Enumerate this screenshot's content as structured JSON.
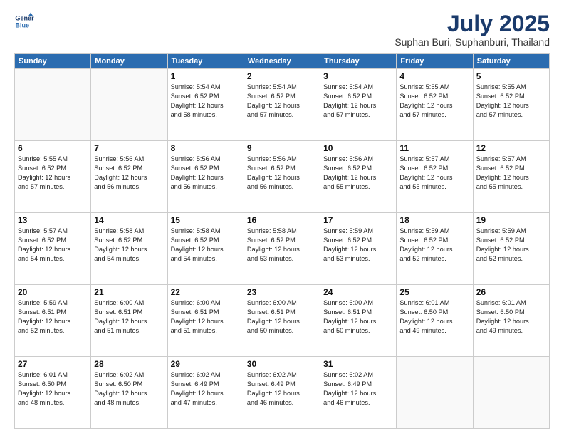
{
  "header": {
    "logo_line1": "General",
    "logo_line2": "Blue",
    "title": "July 2025",
    "subtitle": "Suphan Buri, Suphanburi, Thailand"
  },
  "calendar": {
    "days_of_week": [
      "Sunday",
      "Monday",
      "Tuesday",
      "Wednesday",
      "Thursday",
      "Friday",
      "Saturday"
    ],
    "weeks": [
      [
        {
          "day": "",
          "info": ""
        },
        {
          "day": "",
          "info": ""
        },
        {
          "day": "1",
          "info": "Sunrise: 5:54 AM\nSunset: 6:52 PM\nDaylight: 12 hours\nand 58 minutes."
        },
        {
          "day": "2",
          "info": "Sunrise: 5:54 AM\nSunset: 6:52 PM\nDaylight: 12 hours\nand 57 minutes."
        },
        {
          "day": "3",
          "info": "Sunrise: 5:54 AM\nSunset: 6:52 PM\nDaylight: 12 hours\nand 57 minutes."
        },
        {
          "day": "4",
          "info": "Sunrise: 5:55 AM\nSunset: 6:52 PM\nDaylight: 12 hours\nand 57 minutes."
        },
        {
          "day": "5",
          "info": "Sunrise: 5:55 AM\nSunset: 6:52 PM\nDaylight: 12 hours\nand 57 minutes."
        }
      ],
      [
        {
          "day": "6",
          "info": "Sunrise: 5:55 AM\nSunset: 6:52 PM\nDaylight: 12 hours\nand 57 minutes."
        },
        {
          "day": "7",
          "info": "Sunrise: 5:56 AM\nSunset: 6:52 PM\nDaylight: 12 hours\nand 56 minutes."
        },
        {
          "day": "8",
          "info": "Sunrise: 5:56 AM\nSunset: 6:52 PM\nDaylight: 12 hours\nand 56 minutes."
        },
        {
          "day": "9",
          "info": "Sunrise: 5:56 AM\nSunset: 6:52 PM\nDaylight: 12 hours\nand 56 minutes."
        },
        {
          "day": "10",
          "info": "Sunrise: 5:56 AM\nSunset: 6:52 PM\nDaylight: 12 hours\nand 55 minutes."
        },
        {
          "day": "11",
          "info": "Sunrise: 5:57 AM\nSunset: 6:52 PM\nDaylight: 12 hours\nand 55 minutes."
        },
        {
          "day": "12",
          "info": "Sunrise: 5:57 AM\nSunset: 6:52 PM\nDaylight: 12 hours\nand 55 minutes."
        }
      ],
      [
        {
          "day": "13",
          "info": "Sunrise: 5:57 AM\nSunset: 6:52 PM\nDaylight: 12 hours\nand 54 minutes."
        },
        {
          "day": "14",
          "info": "Sunrise: 5:58 AM\nSunset: 6:52 PM\nDaylight: 12 hours\nand 54 minutes."
        },
        {
          "day": "15",
          "info": "Sunrise: 5:58 AM\nSunset: 6:52 PM\nDaylight: 12 hours\nand 54 minutes."
        },
        {
          "day": "16",
          "info": "Sunrise: 5:58 AM\nSunset: 6:52 PM\nDaylight: 12 hours\nand 53 minutes."
        },
        {
          "day": "17",
          "info": "Sunrise: 5:59 AM\nSunset: 6:52 PM\nDaylight: 12 hours\nand 53 minutes."
        },
        {
          "day": "18",
          "info": "Sunrise: 5:59 AM\nSunset: 6:52 PM\nDaylight: 12 hours\nand 52 minutes."
        },
        {
          "day": "19",
          "info": "Sunrise: 5:59 AM\nSunset: 6:52 PM\nDaylight: 12 hours\nand 52 minutes."
        }
      ],
      [
        {
          "day": "20",
          "info": "Sunrise: 5:59 AM\nSunset: 6:51 PM\nDaylight: 12 hours\nand 52 minutes."
        },
        {
          "day": "21",
          "info": "Sunrise: 6:00 AM\nSunset: 6:51 PM\nDaylight: 12 hours\nand 51 minutes."
        },
        {
          "day": "22",
          "info": "Sunrise: 6:00 AM\nSunset: 6:51 PM\nDaylight: 12 hours\nand 51 minutes."
        },
        {
          "day": "23",
          "info": "Sunrise: 6:00 AM\nSunset: 6:51 PM\nDaylight: 12 hours\nand 50 minutes."
        },
        {
          "day": "24",
          "info": "Sunrise: 6:00 AM\nSunset: 6:51 PM\nDaylight: 12 hours\nand 50 minutes."
        },
        {
          "day": "25",
          "info": "Sunrise: 6:01 AM\nSunset: 6:50 PM\nDaylight: 12 hours\nand 49 minutes."
        },
        {
          "day": "26",
          "info": "Sunrise: 6:01 AM\nSunset: 6:50 PM\nDaylight: 12 hours\nand 49 minutes."
        }
      ],
      [
        {
          "day": "27",
          "info": "Sunrise: 6:01 AM\nSunset: 6:50 PM\nDaylight: 12 hours\nand 48 minutes."
        },
        {
          "day": "28",
          "info": "Sunrise: 6:02 AM\nSunset: 6:50 PM\nDaylight: 12 hours\nand 48 minutes."
        },
        {
          "day": "29",
          "info": "Sunrise: 6:02 AM\nSunset: 6:49 PM\nDaylight: 12 hours\nand 47 minutes."
        },
        {
          "day": "30",
          "info": "Sunrise: 6:02 AM\nSunset: 6:49 PM\nDaylight: 12 hours\nand 46 minutes."
        },
        {
          "day": "31",
          "info": "Sunrise: 6:02 AM\nSunset: 6:49 PM\nDaylight: 12 hours\nand 46 minutes."
        },
        {
          "day": "",
          "info": ""
        },
        {
          "day": "",
          "info": ""
        }
      ]
    ]
  }
}
